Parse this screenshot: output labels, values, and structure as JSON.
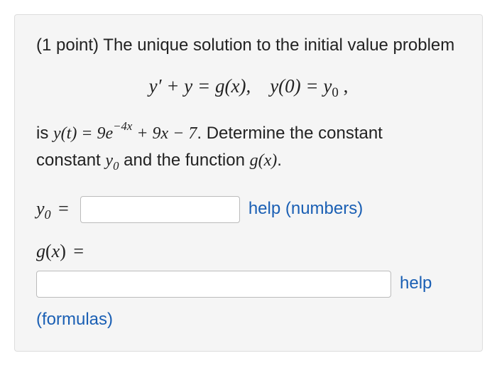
{
  "points_prefix": "(1 point) ",
  "prompt_text": "The unique solution to the initial value problem",
  "equation": "y′ + y = g(x), y(0) = y",
  "equation_sub": "0",
  "equation_tail": " ,",
  "desc_is": "is ",
  "desc_yt": "y(t) = 9e",
  "desc_exp": "−4x",
  "desc_tail1": " + 9x − 7",
  "desc_tail2": ". Determine the constant ",
  "desc_y0": "y",
  "desc_y0_sub": "0",
  "desc_tail3": "  and the function ",
  "desc_gx": "g(x)",
  "desc_period": ".",
  "y0_label": "y",
  "y0_sub": "0",
  "equals": " = ",
  "gx_label": "g(x) = ",
  "help_numbers": "help (numbers)",
  "help": "help",
  "formulas": "(formulas)"
}
